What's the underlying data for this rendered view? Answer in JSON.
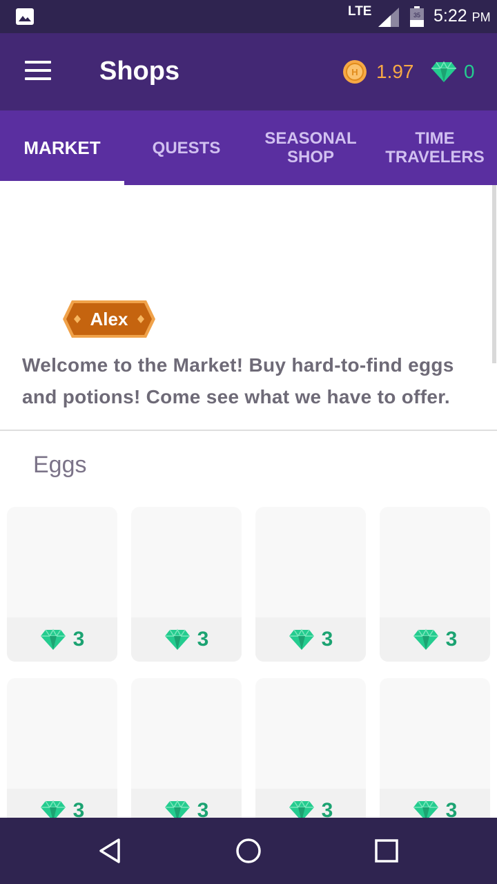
{
  "status_bar": {
    "network": "LTE",
    "battery": "35",
    "time": "5:22",
    "ampm": "PM"
  },
  "app_bar": {
    "title": "Shops",
    "gold": "1.97",
    "gems": "0"
  },
  "tabs": [
    {
      "label": "MARKET",
      "active": true
    },
    {
      "label": "QUESTS",
      "active": false
    },
    {
      "label": "SEASONAL\nSHOP",
      "active": false
    },
    {
      "label": "TIME\nTRAVELERS",
      "active": false
    }
  ],
  "npc": {
    "name": "Alex",
    "welcome": "Welcome to the Market! Buy hard-to-find eggs and potions! Come see what we have to offer."
  },
  "section": {
    "title": "Eggs"
  },
  "items": [
    {
      "price": "3"
    },
    {
      "price": "3"
    },
    {
      "price": "3"
    },
    {
      "price": "3"
    },
    {
      "price": "3"
    },
    {
      "price": "3"
    },
    {
      "price": "3"
    },
    {
      "price": "3"
    }
  ],
  "colors": {
    "status_bar": "#2f2450",
    "app_bar": "#432874",
    "tabs": "#5a2fa0",
    "gold": "#f7a945",
    "gem": "#24cc8f",
    "npc_badge": "#c96a14"
  },
  "icons": [
    "gallery-icon",
    "signal-icon",
    "battery-icon",
    "menu-icon",
    "gold-coin-icon",
    "gem-icon",
    "back-icon",
    "home-icon",
    "recents-icon"
  ]
}
